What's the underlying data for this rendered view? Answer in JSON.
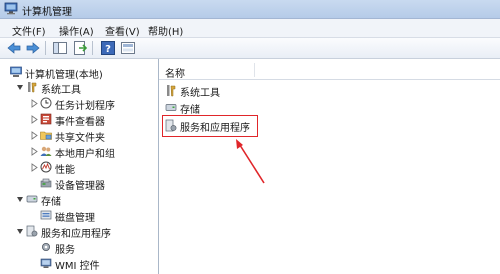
{
  "window": {
    "title": "计算机管理"
  },
  "menu": [
    "文件(F)",
    "操作(A)",
    "查看(V)",
    "帮助(H)"
  ],
  "toolbar": {
    "buttons": [
      "back-icon",
      "forward-icon",
      "show-hide-tree-icon",
      "export-list-icon",
      "help-icon",
      "console-icon"
    ]
  },
  "tree": {
    "root": "计算机管理(本地)",
    "system_tools": "系统工具",
    "task_scheduler": "任务计划程序",
    "event_viewer": "事件查看器",
    "shared_folders": "共享文件夹",
    "local_users": "本地用户和组",
    "performance": "性能",
    "device_manager": "设备管理器",
    "storage": "存储",
    "disk_management": "磁盘管理",
    "services_apps": "服务和应用程序",
    "services": "服务",
    "wmi": "WMI 控件"
  },
  "list": {
    "header_name": "名称",
    "rows": [
      "系统工具",
      "存储",
      "服务和应用程序"
    ]
  },
  "annotation": {
    "color": "#e0262a"
  }
}
